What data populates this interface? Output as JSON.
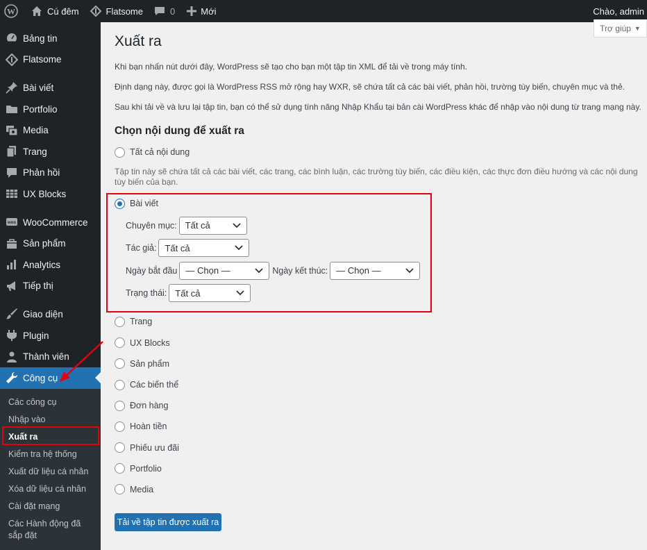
{
  "adminbar": {
    "site_name": "Cú đêm",
    "theme_name": "Flatsome",
    "comments_count": "0",
    "new_label": "Mới",
    "greeting": "Chào, admin"
  },
  "sidebar": {
    "items": [
      {
        "label": "Bảng tin",
        "icon": "dashboard-icon"
      },
      {
        "label": "Flatsome",
        "icon": "flatsome-icon"
      },
      {
        "label": "Bài viết",
        "icon": "pin-icon"
      },
      {
        "label": "Portfolio",
        "icon": "portfolio-icon"
      },
      {
        "label": "Media",
        "icon": "media-icon"
      },
      {
        "label": "Trang",
        "icon": "page-icon"
      },
      {
        "label": "Phản hồi",
        "icon": "comments-icon"
      },
      {
        "label": "UX Blocks",
        "icon": "ux-blocks-icon"
      },
      {
        "label": "WooCommerce",
        "icon": "woocommerce-icon"
      },
      {
        "label": "Sản phẩm",
        "icon": "products-icon"
      },
      {
        "label": "Analytics",
        "icon": "analytics-icon"
      },
      {
        "label": "Tiếp thị",
        "icon": "megaphone-icon"
      },
      {
        "label": "Giao diện",
        "icon": "brush-icon"
      },
      {
        "label": "Plugin",
        "icon": "plugin-icon"
      },
      {
        "label": "Thành viên",
        "icon": "users-icon"
      },
      {
        "label": "Công cụ",
        "icon": "wrench-icon"
      }
    ],
    "submenu": [
      "Các công cụ",
      "Nhập vào",
      "Xuất ra",
      "Kiểm tra hệ thống",
      "Xuất dữ liệu cá nhân",
      "Xóa dữ liệu cá nhân",
      "Cài đặt mạng",
      "Các Hành động đã sắp đặt"
    ]
  },
  "help_tab": "Trợ giúp",
  "page": {
    "title": "Xuất ra",
    "desc1": "Khi bạn nhấn nút dưới đây, WordPress sẽ tạo cho bạn một tập tin XML để tải về trong máy tính.",
    "desc2": "Định dạng này, được gọi là WordPress RSS mở rộng hay WXR, sẽ chứa tất cả các bài viết, phản hồi, trường tùy biến, chuyên mục và thẻ.",
    "desc3": "Sau khi tải về và lưu lại tập tin, bạn có thể sử dụng tính năng Nhập Khẩu tại bản cài WordPress khác để nhập vào nội dung từ trang mạng này.",
    "section_title": "Chọn nội dung để xuất ra",
    "all_content": "Tất cả nội dung",
    "all_note": "Tập tin này sẽ chứa tất cả các bài viết, các trang, các bình luận, các trường tùy biến, các điều kiện, các thực đơn điều hướng và các nội dung tùy biến của bạn.",
    "posts": "Bài viết",
    "filters": {
      "category_label": "Chuyên mục:",
      "category_value": "Tất cả",
      "author_label": "Tác giả:",
      "author_value": "Tất cả",
      "start_label": "Ngày bắt đầu",
      "start_value": "— Chọn —",
      "end_label": "Ngày kết thúc:",
      "end_value": "— Chọn —",
      "status_label": "Trạng thái:",
      "status_value": "Tất cả"
    },
    "other_options": [
      "Trang",
      "UX Blocks",
      "Sản phẩm",
      "Các biến thể",
      "Đơn hàng",
      "Hoàn tiền",
      "Phiếu ưu đãi",
      "Portfolio",
      "Media"
    ],
    "download_button": "Tải về tập tin được xuất ra"
  },
  "colors": {
    "admin_dark": "#1d2327",
    "accent_blue": "#2271b1",
    "annotation_red": "#e3000f"
  }
}
